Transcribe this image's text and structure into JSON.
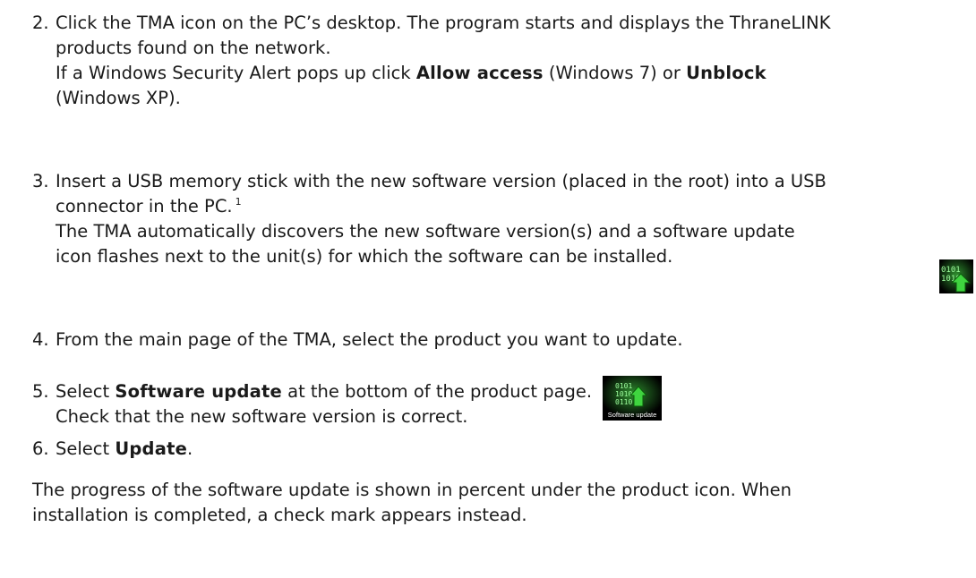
{
  "steps": [
    {
      "number": "2.",
      "line1": "Click the TMA icon on the PC’s desktop. The program starts and displays the ThraneLINK",
      "line2": "products found on the network.",
      "line3_pre": "If a Windows Security Alert pops up click ",
      "line3_bold": "Allow access",
      "line3_mid": " (Windows 7) or ",
      "line3_bold2": "Unblock",
      "line4": "(Windows XP)."
    },
    {
      "number": "3.",
      "line1": "Insert a USB memory stick with the new software version (placed in the root) into a USB",
      "line2": "connector in the PC.",
      "footnote": "1",
      "line3": "The TMA automatically discovers the new software version(s) and a software update",
      "line4": "icon flashes next to the unit(s) for which the software can be installed."
    },
    {
      "number": "4.",
      "line1": "From the main page of the TMA, select the product you want to update."
    },
    {
      "number": "5.",
      "line1_pre": "Select ",
      "line1_bold": "Software update",
      "line1_post": " at the bottom of the product page.",
      "line2": "Check that the new software version is correct.",
      "icon_caption": "Software update"
    },
    {
      "number": "6.",
      "line1_pre": "Select ",
      "line1_bold": "Update",
      "line1_post": "."
    }
  ],
  "closing": {
    "line1": "The progress of the software update is shown in percent under the product icon. When",
    "line2": "installation is completed, a check mark appears instead."
  },
  "icons": {
    "flashing_icon": "software-update-icon",
    "button_icon": "software-update-button-icon",
    "icon_green": "#3fd43f"
  }
}
